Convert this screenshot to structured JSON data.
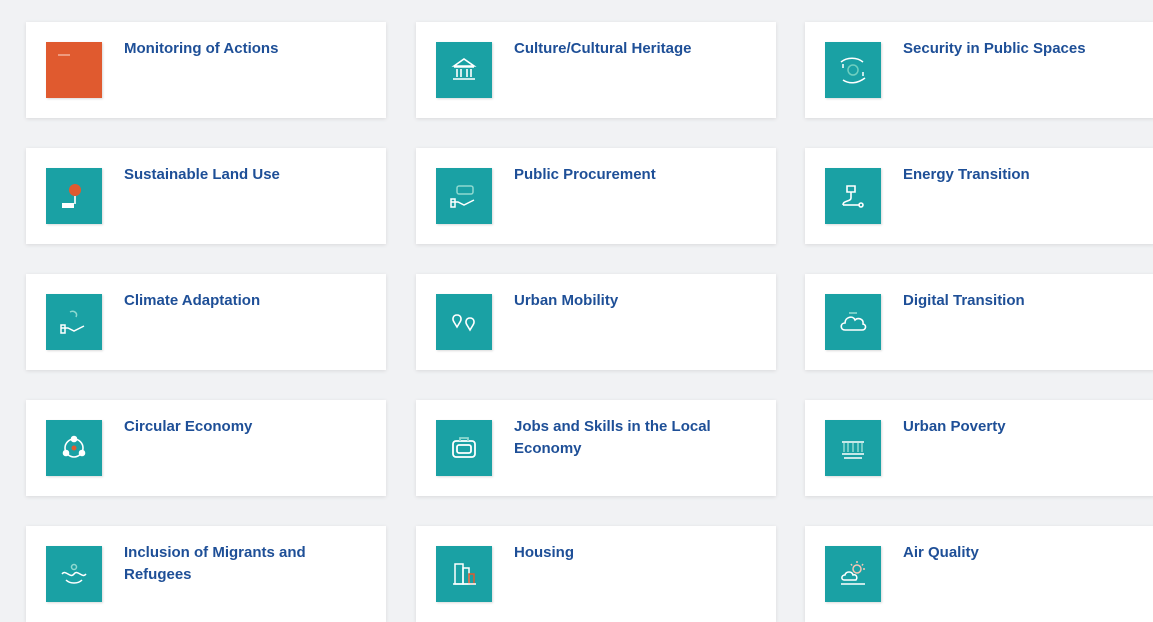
{
  "colors": {
    "teal": "#1aa1a4",
    "orange": "#e05a2f",
    "title_blue": "#1e4f97"
  },
  "cards": [
    {
      "title": "Monitoring of Actions",
      "icon": "monitoring-icon",
      "tile_color": "#e05a2f"
    },
    {
      "title": "Culture/Cultural Heritage",
      "icon": "museum-icon",
      "tile_color": "#1aa1a4"
    },
    {
      "title": "Security in Public Spaces",
      "icon": "security-hands-icon",
      "tile_color": "#1aa1a4"
    },
    {
      "title": "Sustainable Land Use",
      "icon": "land-use-pin-icon",
      "tile_color": "#1aa1a4"
    },
    {
      "title": "Public Procurement",
      "icon": "procurement-hand-icon",
      "tile_color": "#1aa1a4"
    },
    {
      "title": "Energy Transition",
      "icon": "energy-plug-icon",
      "tile_color": "#1aa1a4"
    },
    {
      "title": "Climate Adaptation",
      "icon": "climate-hand-icon",
      "tile_color": "#1aa1a4"
    },
    {
      "title": "Urban Mobility",
      "icon": "location-pins-icon",
      "tile_color": "#1aa1a4"
    },
    {
      "title": "Digital Transition",
      "icon": "cloud-icon",
      "tile_color": "#1aa1a4"
    },
    {
      "title": "Circular Economy",
      "icon": "circular-arrows-icon",
      "tile_color": "#1aa1a4"
    },
    {
      "title": "Jobs and Skills in the Local Economy",
      "icon": "briefcase-icon",
      "tile_color": "#1aa1a4"
    },
    {
      "title": "Urban Poverty",
      "icon": "poverty-icon",
      "tile_color": "#1aa1a4"
    },
    {
      "title": "Inclusion of Migrants and Refugees",
      "icon": "inclusion-hands-icon",
      "tile_color": "#1aa1a4"
    },
    {
      "title": "Housing",
      "icon": "buildings-icon",
      "tile_color": "#1aa1a4"
    },
    {
      "title": "Air Quality",
      "icon": "sun-cloud-icon",
      "tile_color": "#1aa1a4"
    }
  ]
}
